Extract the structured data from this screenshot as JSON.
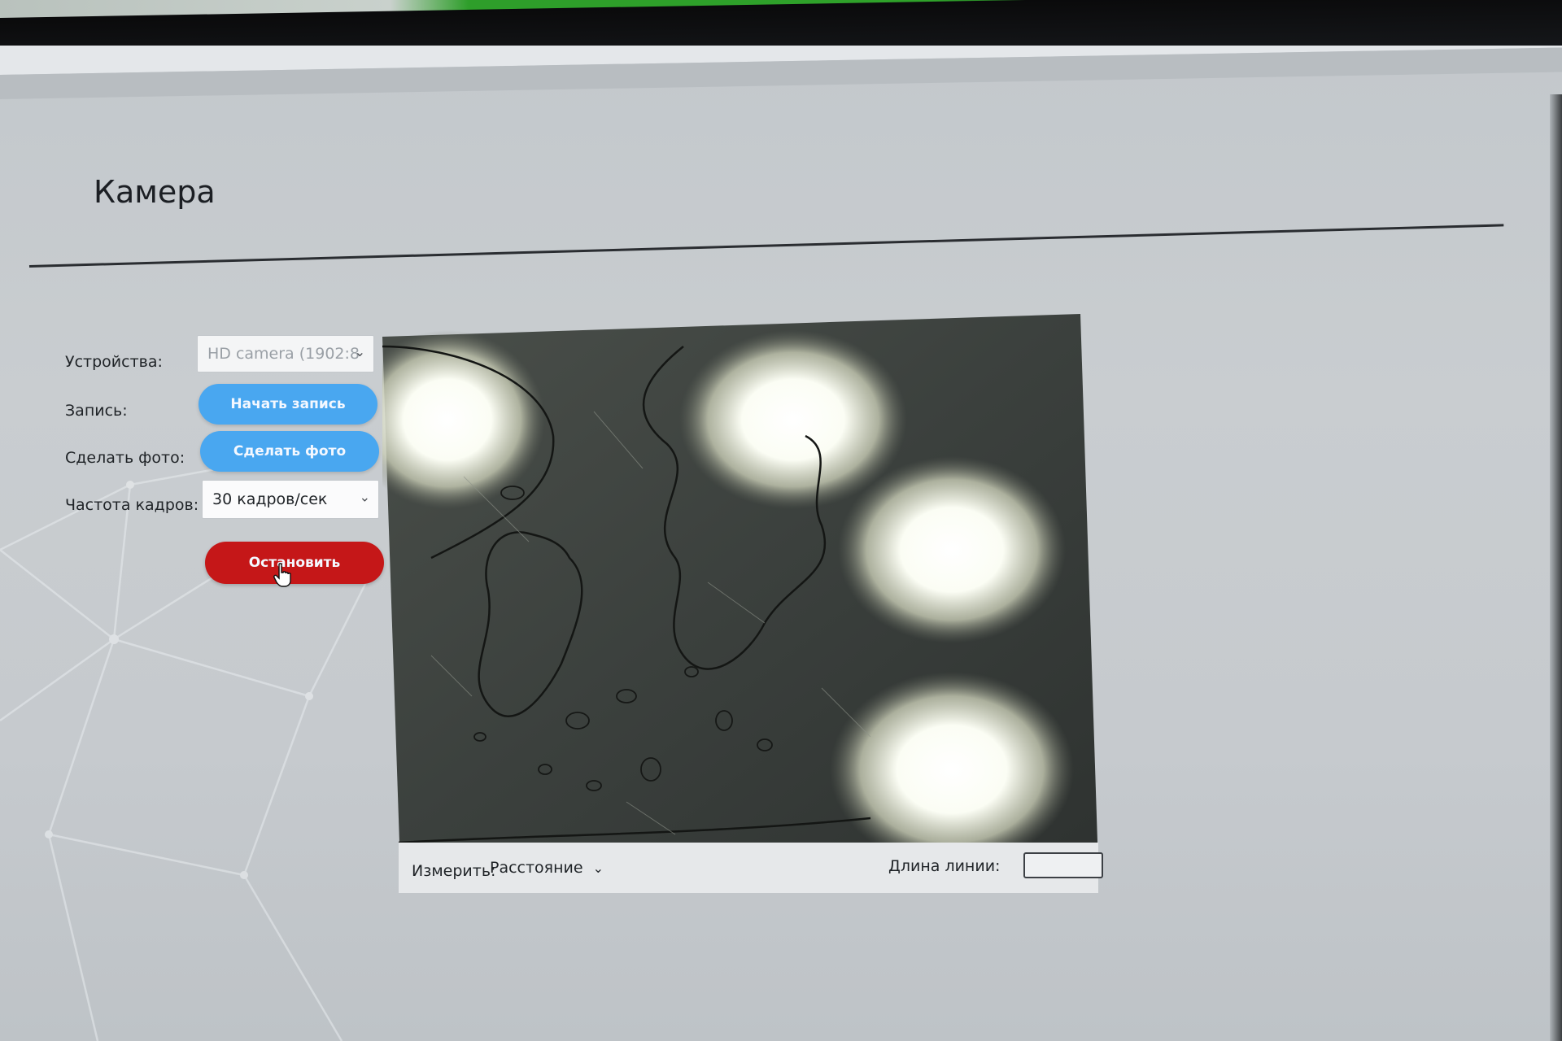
{
  "window": {
    "minimize_glyph": "–",
    "maximize_glyph": "❐",
    "close_glyph": "✕"
  },
  "page": {
    "title": "Камера"
  },
  "controls": {
    "devices_label": "Устройства:",
    "device_value": "HD camera (1902:8",
    "record_label": "Запись:",
    "record_button": "Начать запись",
    "photo_label": "Сделать фото:",
    "photo_button": "Сделать фото",
    "framerate_label": "Частота кадров:",
    "framerate_value": "30 кадров/сек",
    "stop_button": "Остановить"
  },
  "measure": {
    "label": "Измерить:",
    "mode_value": "Расстояние",
    "line_length_label": "Длина линии:",
    "line_length_value": ""
  },
  "colors": {
    "accent_blue": "#49a7f0",
    "stop_red": "#c51718"
  },
  "icons": {
    "chevron": "chevron-down-icon",
    "cursor": "hand-cursor-icon"
  }
}
